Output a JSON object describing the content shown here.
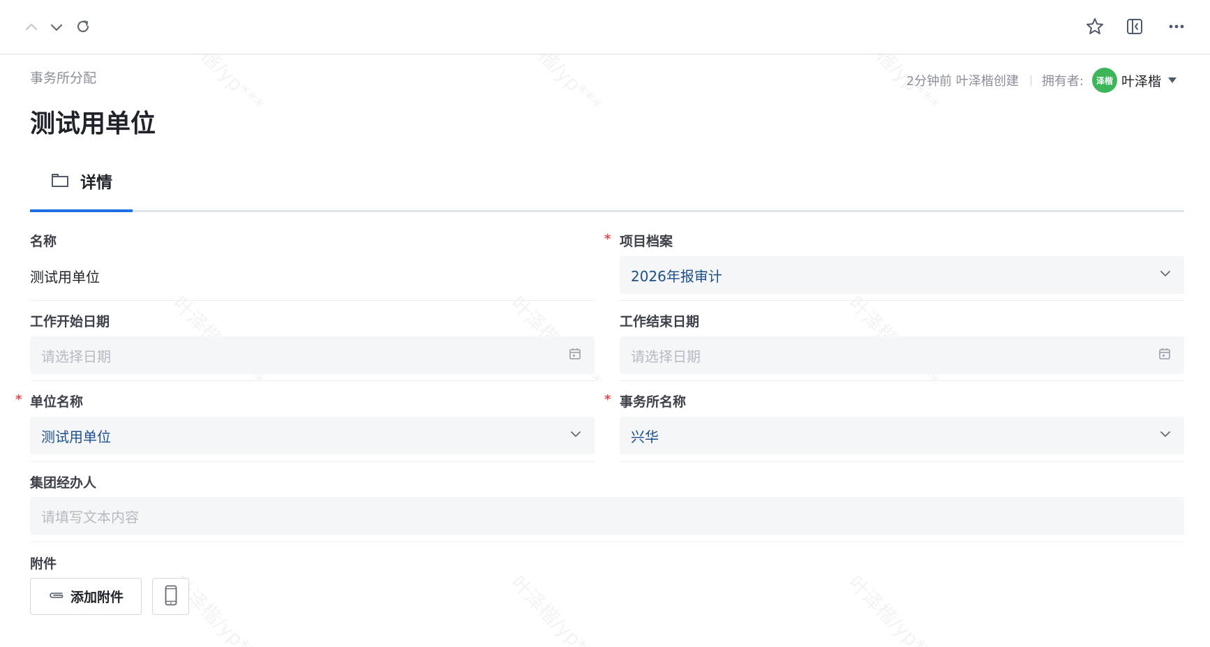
{
  "toolbar": {
    "icons": [
      "chevron-up-icon",
      "chevron-down-icon",
      "refresh-icon",
      "star-icon",
      "sidebar-collapse-icon",
      "more-icon"
    ]
  },
  "header": {
    "breadcrumb": "事务所分配",
    "created_text": "2分钟前 叶泽楷创建",
    "owner_label": "拥有者:",
    "owner_avatar_text": "泽楷",
    "owner_name": "叶泽楷",
    "title": "测试用单位"
  },
  "tabs": [
    {
      "label": "详情",
      "icon": "folder-icon",
      "active": true
    }
  ],
  "form": {
    "name": {
      "label": "名称",
      "value": "测试用单位"
    },
    "project_file": {
      "label": "项目档案",
      "required": "*",
      "value": "2026年报审计"
    },
    "start_date": {
      "label": "工作开始日期",
      "placeholder": "请选择日期"
    },
    "end_date": {
      "label": "工作结束日期",
      "placeholder": "请选择日期"
    },
    "unit_name": {
      "label": "单位名称",
      "required": "*",
      "value": "测试用单位"
    },
    "firm_name": {
      "label": "事务所名称",
      "required": "*",
      "value": "兴华"
    },
    "group_agent": {
      "label": "集团经办人",
      "placeholder": "请填写文本内容"
    },
    "attachments": {
      "label": "附件",
      "add_button": "添加附件"
    }
  },
  "watermark": "叶泽楷/yp***",
  "colors": {
    "accent": "#1f6fe5",
    "value_text": "#1c4f8c",
    "required": "#e5484d",
    "avatar": "#3db65a",
    "field_bg": "#f5f6f7"
  }
}
